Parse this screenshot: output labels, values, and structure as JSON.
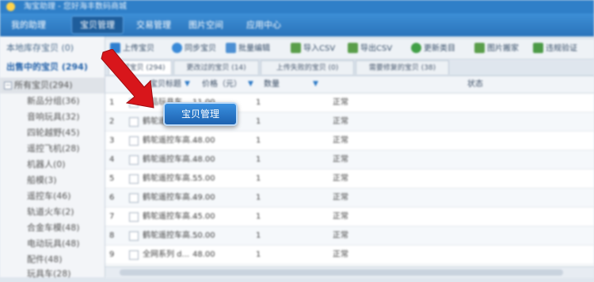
{
  "title_bar": {
    "title": "淘宝助理 - 您好海丰数码商城"
  },
  "nav": {
    "items": [
      {
        "label": "我的助理"
      },
      {
        "label": "宝贝管理",
        "active": true
      },
      {
        "label": "交易管理"
      },
      {
        "label": "图片空间"
      },
      {
        "label": "应用中心"
      }
    ]
  },
  "sidebar": {
    "local_library": "本地库存宝贝 (0)",
    "on_sale": "出售中的宝贝 (294)",
    "categories": [
      {
        "label": "所有宝贝(294)",
        "root": true
      },
      {
        "label": "新品分组(36)"
      },
      {
        "label": "音响玩具(32)"
      },
      {
        "label": "四轮越野(45)"
      },
      {
        "label": "遥控飞机(28)"
      },
      {
        "label": "机器人(0)"
      },
      {
        "label": "船模(3)"
      },
      {
        "label": "遥控车(46)"
      },
      {
        "label": "轨道火车(2)"
      },
      {
        "label": "合金车模(48)"
      },
      {
        "label": "电动玩具(48)"
      },
      {
        "label": "配件(48)"
      },
      {
        "label": "玩具车(28)"
      }
    ]
  },
  "toolbar": {
    "buttons": [
      {
        "label": "上传宝贝",
        "color": "#2f7fd0"
      },
      {
        "label": "同步宝贝",
        "color": "#3a8ad8"
      },
      {
        "label": "批量编辑",
        "color": "#4c8fd3"
      },
      {
        "label": "导入CSV",
        "color": "#5a9e4a"
      },
      {
        "label": "导出CSV",
        "color": "#5a9e4a"
      },
      {
        "label": "更新类目",
        "color": "#42a047"
      },
      {
        "label": "图片搬家",
        "color": "#5a9e4a"
      },
      {
        "label": "违规验证",
        "color": "#4c9a46"
      }
    ]
  },
  "subtabs": [
    {
      "label": "全部宝贝 (294)",
      "active": true
    },
    {
      "label": "更改过的宝贝 (14)"
    },
    {
      "label": "上传失败的宝贝 (0)"
    },
    {
      "label": "需要修复的宝贝 (38)"
    }
  ],
  "table": {
    "headers": {
      "title": "宝贝标题",
      "price": "价格（元）",
      "qty": "数量",
      "status": "状态"
    },
    "rows": [
      {
        "n": "1",
        "title": "新品玩具车...",
        "price": "11.00",
        "qty": "1",
        "status": "正常"
      },
      {
        "n": "2",
        "title": "鹤鸵遥控...",
        "price": "",
        "qty": "1",
        "status": "正常"
      },
      {
        "n": "3",
        "title": "鹤鸵遥控车高...",
        "price": "48.00",
        "qty": "1",
        "status": "正常"
      },
      {
        "n": "4",
        "title": "鹤鸵遥控车高...",
        "price": "48.00",
        "qty": "1",
        "status": "正常"
      },
      {
        "n": "5",
        "title": "鹤鸵遥控车高...",
        "price": "55.00",
        "qty": "1",
        "status": "正常"
      },
      {
        "n": "6",
        "title": "鹤鸵遥控车高...",
        "price": "49.00",
        "qty": "1",
        "status": "正常"
      },
      {
        "n": "7",
        "title": "鹤鸵遥控车高...",
        "price": "45.00",
        "qty": "1",
        "status": "正常"
      },
      {
        "n": "8",
        "title": "鹤鸵遥控车高...",
        "price": "50.00",
        "qty": "1",
        "status": "正常"
      },
      {
        "n": "9",
        "title": "全网系列 d...",
        "price": "48.00",
        "qty": "1",
        "status": "正常"
      }
    ]
  },
  "callout": {
    "label": "宝贝管理",
    "arrow_color": "#d8161b"
  }
}
